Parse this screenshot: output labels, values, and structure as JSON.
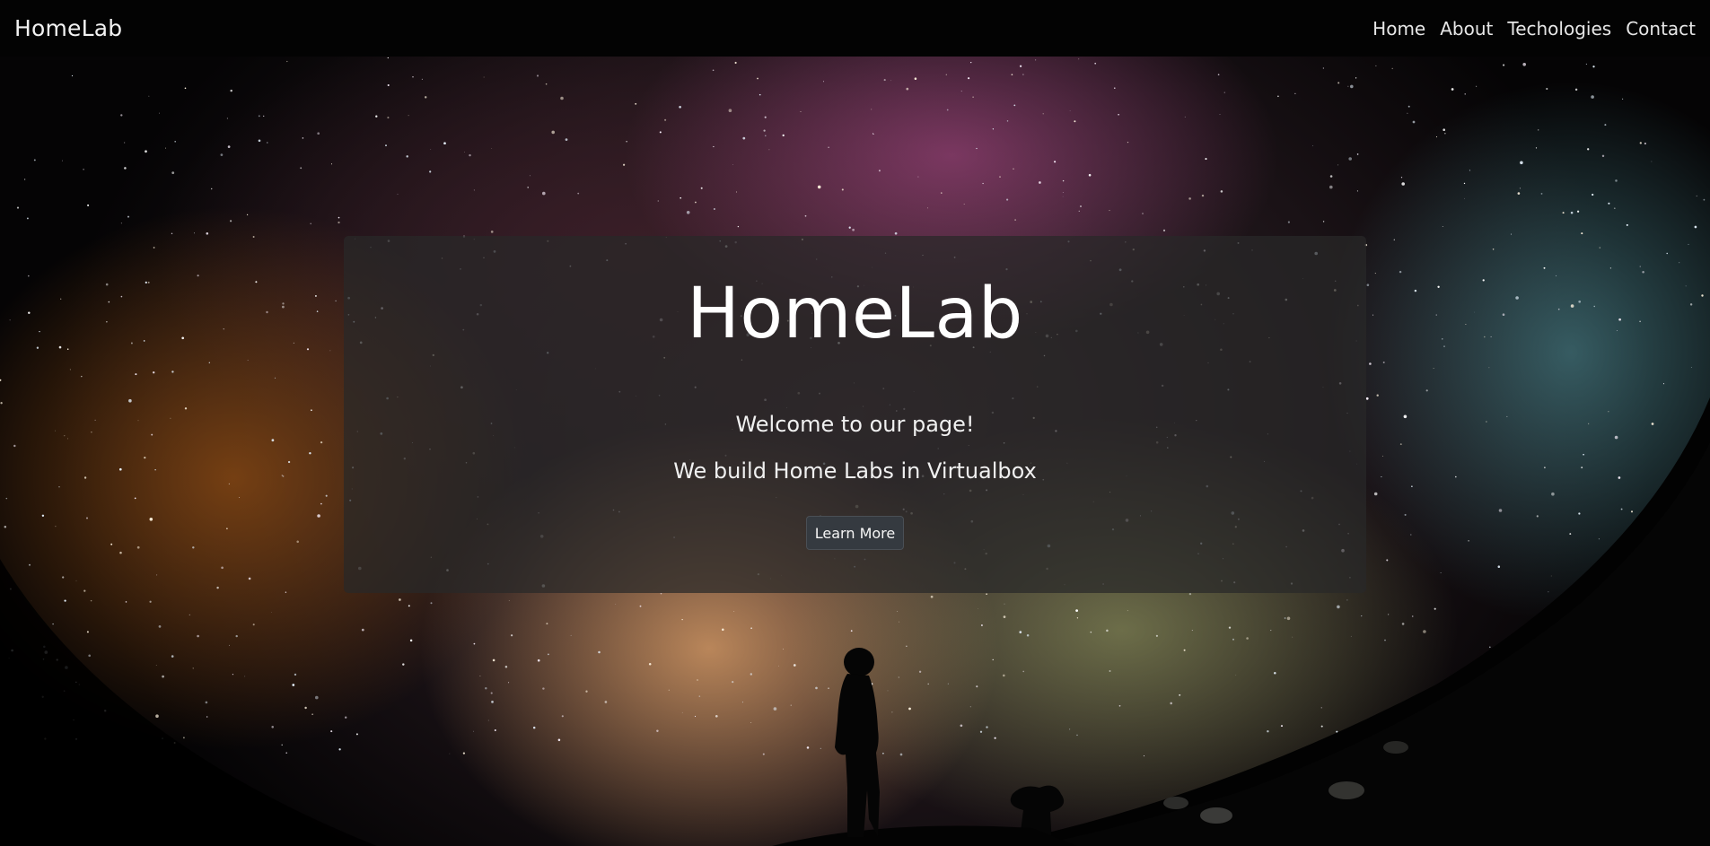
{
  "navbar": {
    "brand": "HomeLab",
    "links": [
      {
        "label": "Home"
      },
      {
        "label": "About"
      },
      {
        "label": "Techologies"
      },
      {
        "label": "Contact"
      }
    ]
  },
  "hero": {
    "title": "HomeLab",
    "lead1": "Welcome to our page!",
    "lead2": "We build Home Labs in Virtualbox",
    "button_label": "Learn More",
    "background_image": "starry-night-sky-with-person-silhouette"
  },
  "colors": {
    "navbar_bg": "#030303",
    "card_bg": "rgba(40,40,40,0.72)",
    "button_bg": "#353a40",
    "text": "#ffffff"
  }
}
